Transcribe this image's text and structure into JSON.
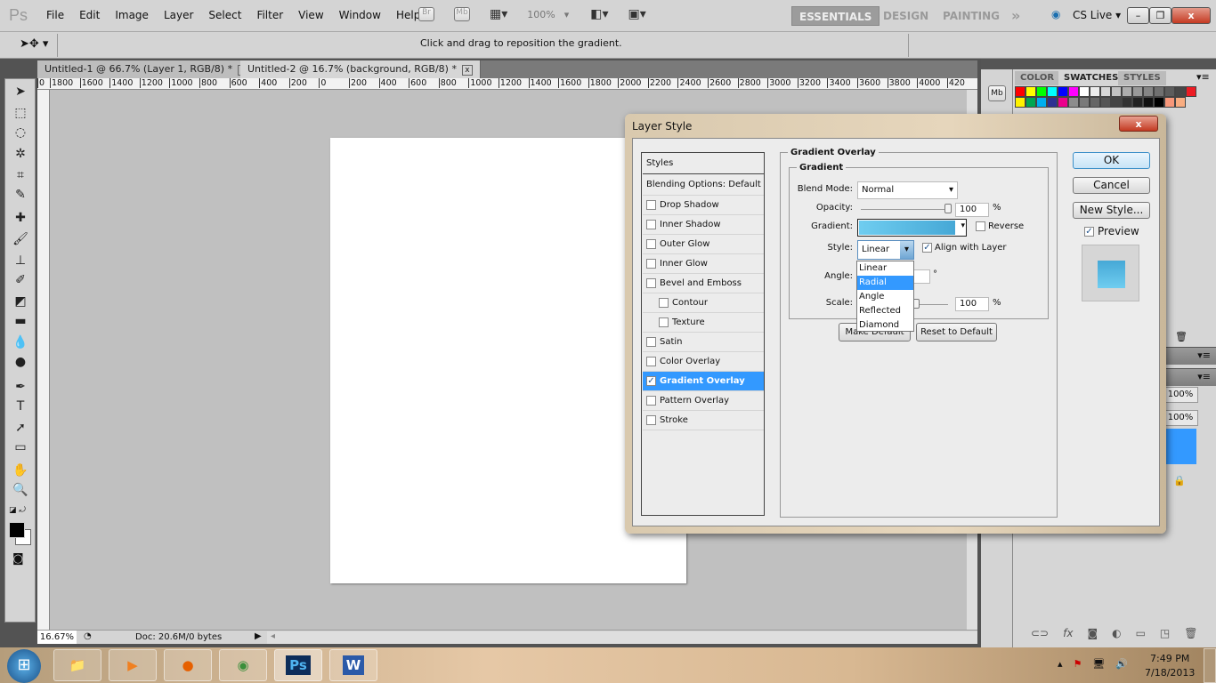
{
  "app": {
    "logo": "Ps",
    "menu": [
      "File",
      "Edit",
      "Image",
      "Layer",
      "Select",
      "Filter",
      "View",
      "Window",
      "Help"
    ],
    "bridge_label": "Br",
    "minibridge_label": "Mb",
    "zoom_level": "100%",
    "workspaces": [
      "ESSENTIALS",
      "DESIGN",
      "PAINTING"
    ],
    "more_workspaces": "»",
    "cs_live": "CS Live"
  },
  "options_bar": {
    "hint": "Click and drag to reposition the gradient."
  },
  "doc_tabs": [
    {
      "label": "Untitled-1 @ 66.7% (Layer 1, RGB/8) *",
      "active": false
    },
    {
      "label": "Untitled-2 @ 16.7% (background, RGB/8) *",
      "active": true
    }
  ],
  "ruler": [
    "0",
    "1800",
    "1600",
    "1400",
    "1200",
    "1000",
    "800",
    "600",
    "400",
    "200",
    "0",
    "200",
    "400",
    "600",
    "800",
    "1000",
    "1200",
    "1400",
    "1600",
    "1800",
    "2000",
    "2200",
    "2400",
    "2600",
    "2800",
    "3000",
    "3200",
    "3400",
    "3600",
    "3800",
    "4000",
    "420"
  ],
  "status": {
    "zoom": "16.67%",
    "doc": "Doc: 20.6M/0 bytes"
  },
  "panels": {
    "tabs": [
      "COLOR",
      "SWATCHES",
      "STYLES"
    ],
    "active_tab": "SWATCHES",
    "mb": "Mb",
    "opacity": "100%",
    "fill": "100%",
    "swatch_colors": [
      "#ff0000",
      "#ffff00",
      "#00ff00",
      "#00ffff",
      "#0000ff",
      "#ff00ff",
      "#ffffff",
      "#ebebeb",
      "#d6d6d6",
      "#c2c2c2",
      "#adadad",
      "#999999",
      "#858585",
      "#707070",
      "#5c5c5c",
      "#474747",
      "#ed1c24",
      "#fff200",
      "#00a651",
      "#00aeef",
      "#2e3192",
      "#ec008c",
      "#8c8c8c",
      "#7a7a7a",
      "#666666",
      "#555555",
      "#444444",
      "#333333",
      "#222222",
      "#111111",
      "#000000",
      "#f7977a",
      "#f9ad81"
    ]
  },
  "dialog": {
    "title": "Layer Style",
    "close": "x",
    "styles_header": "Styles",
    "blending": "Blending Options: Default",
    "effects": [
      {
        "label": "Drop Shadow",
        "checked": false,
        "indent": false
      },
      {
        "label": "Inner Shadow",
        "checked": false,
        "indent": false
      },
      {
        "label": "Outer Glow",
        "checked": false,
        "indent": false
      },
      {
        "label": "Inner Glow",
        "checked": false,
        "indent": false
      },
      {
        "label": "Bevel and Emboss",
        "checked": false,
        "indent": false
      },
      {
        "label": "Contour",
        "checked": false,
        "indent": true
      },
      {
        "label": "Texture",
        "checked": false,
        "indent": true
      },
      {
        "label": "Satin",
        "checked": false,
        "indent": false
      },
      {
        "label": "Color Overlay",
        "checked": false,
        "indent": false
      },
      {
        "label": "Gradient Overlay",
        "checked": true,
        "indent": false,
        "selected": true
      },
      {
        "label": "Pattern Overlay",
        "checked": false,
        "indent": false
      },
      {
        "label": "Stroke",
        "checked": false,
        "indent": false
      }
    ],
    "section": "Gradient Overlay",
    "group": "Gradient",
    "blend_mode_label": "Blend Mode:",
    "blend_mode": "Normal",
    "opacity_label": "Opacity:",
    "opacity": "100",
    "opacity_value": 100,
    "pct": "%",
    "gradient_label": "Gradient:",
    "reverse_label": "Reverse",
    "reverse_checked": false,
    "style_label": "Style:",
    "style": "Linear",
    "align_label": "Align with Layer",
    "align_checked": true,
    "angle_label": "Angle:",
    "degree": "°",
    "scale_label": "Scale:",
    "scale": "100",
    "scale_value": 100,
    "style_options": [
      "Linear",
      "Radial",
      "Angle",
      "Reflected",
      "Diamond"
    ],
    "highlighted_option": "Radial",
    "make_default": "Make Default",
    "reset_default": "Reset to Default",
    "ok": "OK",
    "cancel": "Cancel",
    "new_style": "New Style...",
    "preview_label": "Preview",
    "preview_checked": true,
    "gradient_colors": [
      "#6fcdf0",
      "#46a8d6"
    ]
  },
  "taskbar": {
    "time": "7:49 PM",
    "date": "7/18/2013",
    "apps": [
      "explorer",
      "media-player",
      "firefox",
      "chrome",
      "photoshop",
      "word"
    ],
    "ps": "Ps",
    "word": "W"
  }
}
